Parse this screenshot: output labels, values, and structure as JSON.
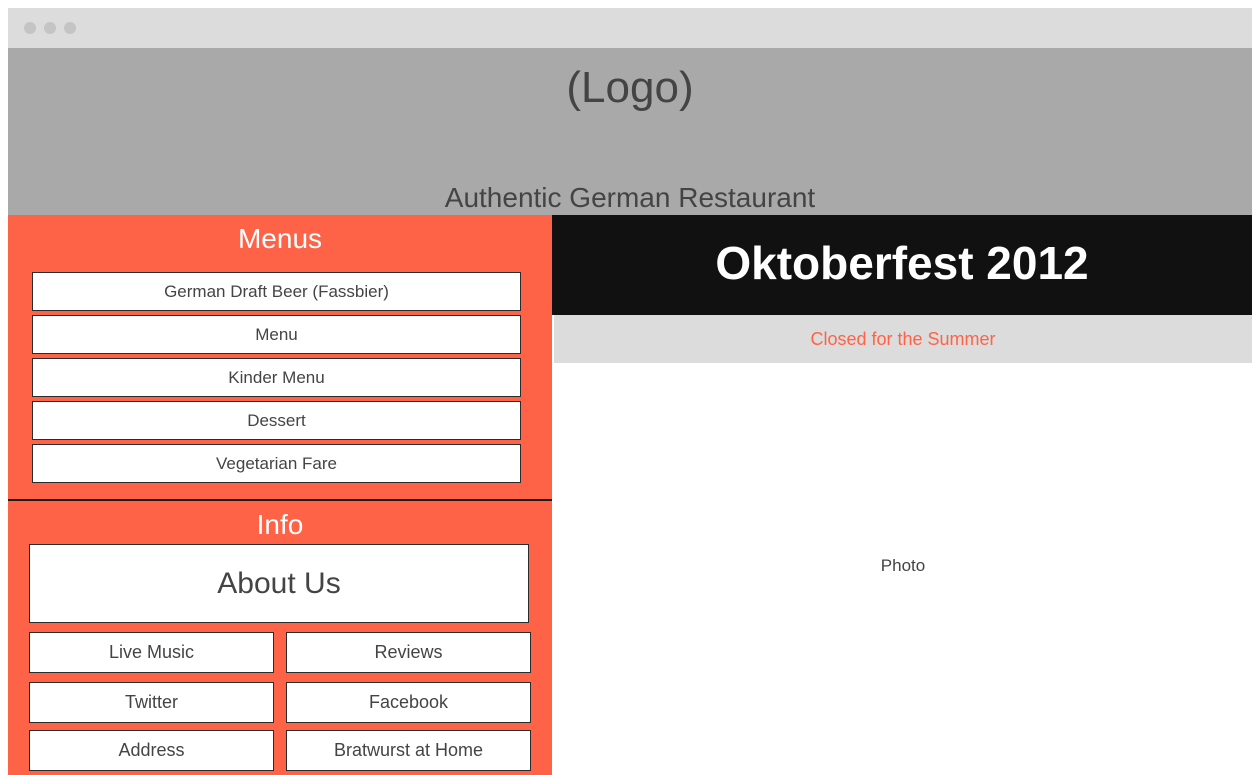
{
  "header": {
    "logo": "(Logo)",
    "tagline": "Authentic German Restaurant"
  },
  "sidebar": {
    "menus_title": "Menus",
    "menu_items": [
      {
        "label": "German Draft Beer (Fassbier)"
      },
      {
        "label": "Menu"
      },
      {
        "label": "Kinder Menu"
      },
      {
        "label": "Dessert"
      },
      {
        "label": "Vegetarian Fare"
      }
    ],
    "info_title": "Info",
    "about_label": "About Us",
    "info_items": [
      {
        "label": "Live Music"
      },
      {
        "label": "Reviews"
      },
      {
        "label": "Twitter"
      },
      {
        "label": "Facebook"
      },
      {
        "label": "Address"
      },
      {
        "label": "Bratwurst at Home"
      }
    ]
  },
  "main": {
    "hero_title": "Oktoberfest 2012",
    "notice": "Closed for the Summer",
    "photo_label": "Photo"
  },
  "colors": {
    "accent": "#ff6347",
    "header_bg": "#a9a9a9",
    "hero_bg": "#111111",
    "notice_bg": "#dcdcdc"
  }
}
